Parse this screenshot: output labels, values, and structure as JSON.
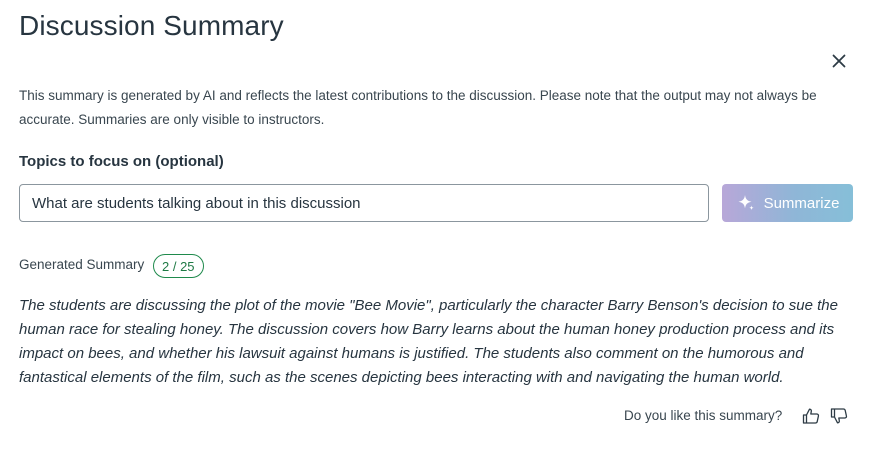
{
  "header": {
    "title": "Discussion Summary"
  },
  "disclaimer": "This summary is generated by AI and reflects the latest contributions to the discussion. Please note that the output may not always be accurate. Summaries are only visible to instructors.",
  "topics": {
    "label": "Topics to focus on (optional)",
    "value": "What are students talking about in this discussion"
  },
  "summarize_button": {
    "label": "Summarize",
    "icon": "sparkle-icon"
  },
  "generated": {
    "label": "Generated Summary",
    "count": "2 / 25",
    "text": "The students are discussing the plot of the movie \"Bee Movie\", particularly the character Barry Benson's decision to sue the human race for stealing honey. The discussion covers how Barry learns about the human honey production process and its impact on bees, and whether his lawsuit against humans is justified. The students also comment on the humorous and fantastical elements of the film, such as the scenes depicting bees interacting with and navigating the human world."
  },
  "feedback": {
    "question": "Do you like this summary?",
    "like_icon": "thumbs-up-icon",
    "dislike_icon": "thumbs-down-icon"
  },
  "colors": {
    "badge": "#1f8a4c",
    "button_gradient_start": "#b8a7d8",
    "button_gradient_end": "#86bfd8",
    "text": "#273540"
  }
}
